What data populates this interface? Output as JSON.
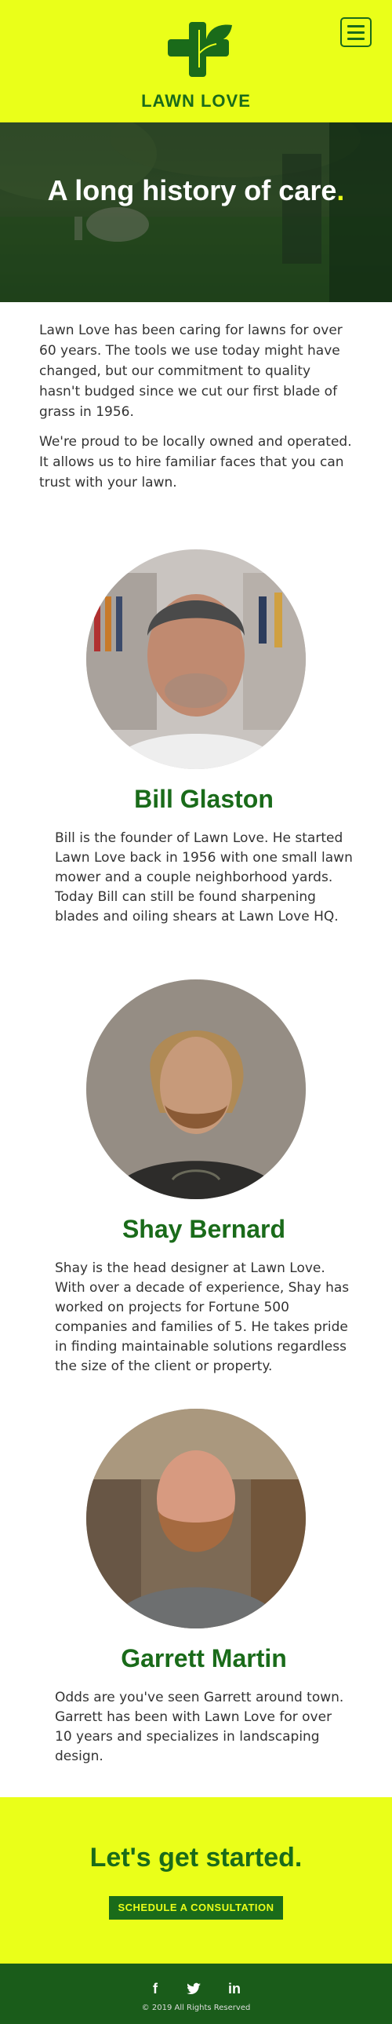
{
  "brand": {
    "name": "LAWN LOVE",
    "logo_icon": "plant-cross-icon",
    "primary_color": "#1a6b1a",
    "accent_color": "#eaff19"
  },
  "header": {
    "menu_icon": "hamburger-menu-icon"
  },
  "hero": {
    "title": "A long history of care",
    "title_end": "."
  },
  "intro": {
    "paragraphs": [
      "Lawn Love has been caring for lawns for over 60 years. The tools we use today might have changed, but our commitment to quality hasn't budged since we cut our first blade of grass in 1956.",
      "We're proud to be locally owned and operated. It allows us to hire familiar faces that you can trust with your lawn."
    ]
  },
  "team": [
    {
      "name": "Bill Glaston",
      "bio": "Bill is the founder of Lawn Love. He started Lawn Love back in 1956 with one small lawn mower and a couple neighborhood yards. Today Bill can still be found sharpening blades and oiling shears at Lawn Love HQ."
    },
    {
      "name": "Shay Bernard",
      "bio": "Shay is the head designer at Lawn Love. With over a decade of experience, Shay has worked on projects for Fortune 500 companies and families of 5. He takes pride in finding maintainable solutions regardless the size of the client or property."
    },
    {
      "name": "Garrett Martin",
      "bio": "Odds are you've seen Garrett around town. Garrett has been with Lawn Love for over 10 years and specializes in landscaping design."
    }
  ],
  "cta": {
    "title": "Let's get started.",
    "button_label": "SCHEDULE A CONSULTATION"
  },
  "footer": {
    "social": [
      {
        "icon": "facebook-icon",
        "glyph": "f"
      },
      {
        "icon": "twitter-icon",
        "glyph": "t"
      },
      {
        "icon": "linkedin-icon",
        "glyph": "in"
      }
    ],
    "copyright": "© 2019 All Rights Reserved"
  }
}
